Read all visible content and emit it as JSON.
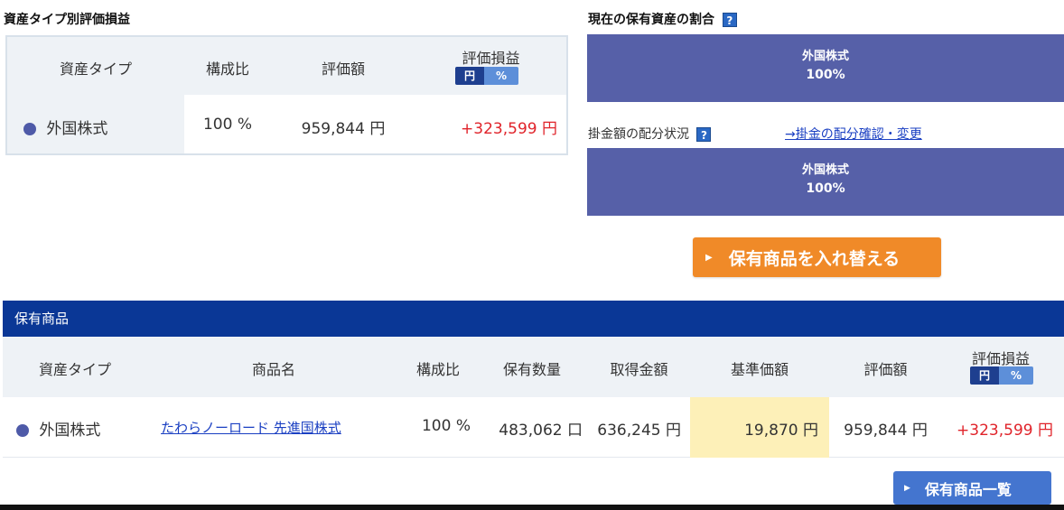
{
  "asset_section": {
    "title": "資産タイプ別評価損益",
    "headers": {
      "type": "資産タイプ",
      "ratio": "構成比",
      "valuation": "評価額",
      "gain": "評価損益"
    },
    "toggle": {
      "yen": "円",
      "pct": "%"
    },
    "row": {
      "type": "外国株式",
      "ratio": "100 %",
      "valuation": "959,844 円",
      "gain": "+323,599 円"
    }
  },
  "allocation": {
    "title": "現在の保有資産の割合",
    "help": "?",
    "current": {
      "label": "外国株式",
      "pct": "100%"
    },
    "contribution_label": "掛金額の配分状況",
    "contribution_link": "→掛金の配分確認・変更",
    "contribution": {
      "label": "外国株式",
      "pct": "100%"
    },
    "swap_button": "保有商品を入れ替える",
    "arrow": "▶"
  },
  "holdings": {
    "title": "保有商品",
    "headers": {
      "type": "資産タイプ",
      "name": "商品名",
      "ratio": "構成比",
      "quantity": "保有数量",
      "cost": "取得金額",
      "base_price": "基準価額",
      "valuation": "評価額",
      "gain": "評価損益"
    },
    "toggle": {
      "yen": "円",
      "pct": "%"
    },
    "row": {
      "type": "外国株式",
      "name": "たわらノーロード 先進国株式",
      "ratio": "100 %",
      "quantity": "483,062 口",
      "cost": "636,245 円",
      "base_price": "19,870 円",
      "valuation": "959,844 円",
      "gain": "+323,599 円"
    },
    "list_button": "保有商品一覧"
  },
  "colors": {
    "header_blue": "#0a3796",
    "alloc_purple": "#5660a8",
    "orange": "#f08a28",
    "gain_red": "#e0232a",
    "highlight_yellow": "#fdf0b8"
  },
  "icons": {
    "dot": "series-dot-icon",
    "help": "help-icon",
    "arrow": "arrow-right-icon"
  }
}
